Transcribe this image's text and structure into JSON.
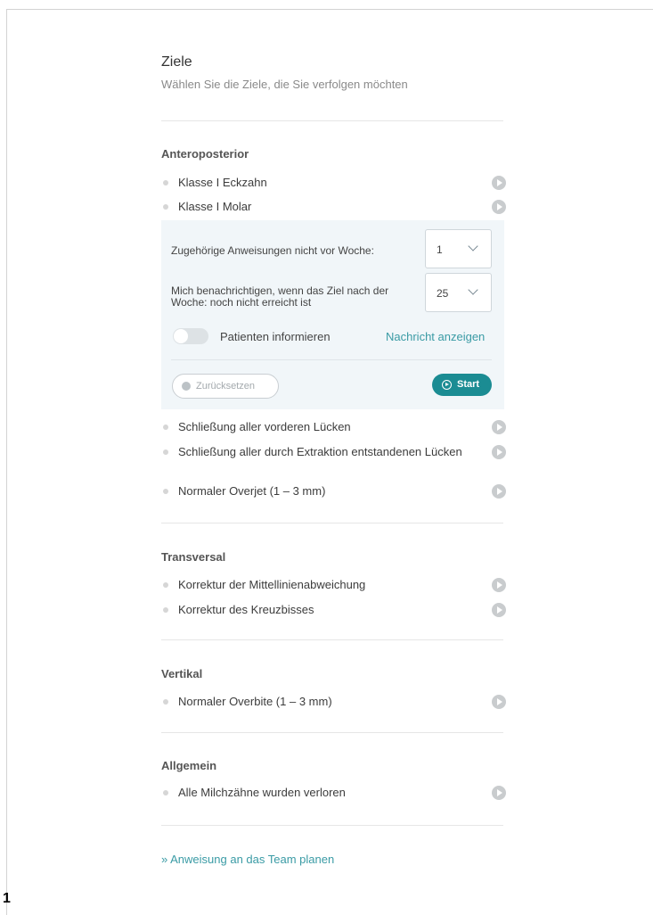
{
  "header": {
    "title": "Ziele",
    "subtitle": "Wählen Sie die Ziele, die Sie verfolgen möchten"
  },
  "sections": [
    {
      "title": "Anteroposterior",
      "goals_before": [
        "Klasse I Eckzahn",
        "Klasse I Molar"
      ],
      "goals_after": [
        "Schließung aller vorderen Lücken",
        "Schließung aller durch Extraktion entstandenen Lücken",
        "Normaler Overjet (1 – 3 mm)"
      ]
    },
    {
      "title": "Transversal",
      "goals": [
        "Korrektur der Mittellinienabweichung",
        "Korrektur des Kreuzbisses"
      ]
    },
    {
      "title": "Vertikal",
      "goals": [
        "Normaler Overbite (1 – 3 mm)"
      ]
    },
    {
      "title": "Allgemein",
      "goals": [
        "Alle Milchzähne wurden verloren"
      ]
    }
  ],
  "panel": {
    "week_label": "Zugehörige Anweisungen nicht vor Woche:",
    "week_value": "1",
    "notify_label_line1": "Mich benachrichtigen, wenn das Ziel nach der",
    "notify_label_line2": "Woche: noch nicht erreicht ist",
    "notify_value": "25",
    "toggle_label": "Patienten informieren",
    "toggle_on": false,
    "message_link": "Nachricht anzeigen",
    "reset_label": "Zurücksetzen",
    "start_label": "Start"
  },
  "footer": {
    "plan_link": "» Anweisung an das Team planen"
  },
  "page_number": "1",
  "icons": {
    "goal_action": "play-circle-icon",
    "reset": "reset-icon",
    "start": "play-circle-icon"
  },
  "colors": {
    "accent": "#1b8c93",
    "link": "#3a9ba5",
    "panel_bg": "#f1f6f9"
  }
}
